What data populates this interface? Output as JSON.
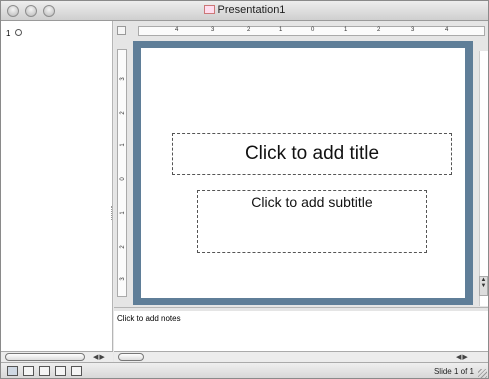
{
  "window": {
    "title": "Presentation1"
  },
  "slide_list": {
    "items": [
      {
        "number": "1"
      }
    ]
  },
  "ruler": {
    "horizontal_labels": [
      "4",
      "3",
      "2",
      "1",
      "0",
      "1",
      "2",
      "3",
      "4"
    ],
    "vertical_labels": [
      "3",
      "2",
      "1",
      "0",
      "1",
      "2",
      "3"
    ]
  },
  "slide": {
    "title_placeholder": "Click to add title",
    "subtitle_placeholder": "Click to add subtitle",
    "frame_color": "#5f7e98"
  },
  "notes": {
    "placeholder": "Click to add notes"
  },
  "status": {
    "slide_position": "Slide 1 of 1"
  },
  "view_buttons": [
    "normal-view-icon",
    "outline-view-icon",
    "slide-view-icon",
    "slide-sorter-icon",
    "slideshow-icon"
  ]
}
